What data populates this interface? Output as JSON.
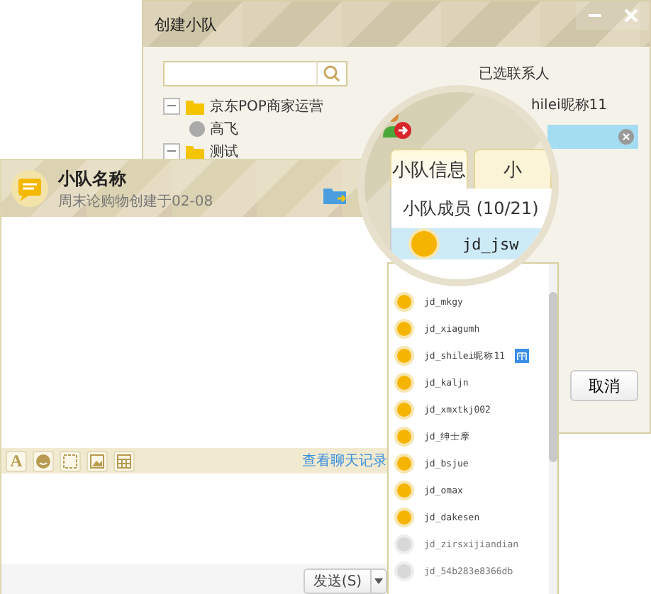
{
  "back_window": {
    "title": "创建小队",
    "tree": [
      {
        "label": "京东POP商家运营",
        "kind": "folder",
        "expanded": true,
        "children": [
          {
            "label": "高飞",
            "kind": "contact"
          }
        ]
      },
      {
        "label": "测试",
        "kind": "folder",
        "expanded": true
      }
    ],
    "selected_header": "已选联系人",
    "selected_contacts": [
      {
        "label": "hilei昵称11",
        "selected": false
      },
      {
        "selected": true
      }
    ],
    "buttons": [
      "取消"
    ]
  },
  "chat_window": {
    "font_button": "A",
    "team_name": "小队名称",
    "subtitle": "周末论购物创建于02-08",
    "history_link": "查看聊天记录",
    "send_button": "发送(S)"
  },
  "magnifier": {
    "tabs": [
      {
        "label": "小队信息",
        "selected": true
      },
      {
        "label": "小",
        "selected": false
      }
    ],
    "members_header": "小队成员 (10/21)",
    "highlighted_member": "jd_jsw"
  },
  "members": [
    {
      "name": "jd_mkgy",
      "online": true,
      "badge": false
    },
    {
      "name": "jd_xiagumh",
      "online": true,
      "badge": false
    },
    {
      "name": "jd_shilei昵称11",
      "online": true,
      "badge": true
    },
    {
      "name": "jd_kaljn",
      "online": true,
      "badge": false
    },
    {
      "name": "jd_xmxtkj002",
      "online": true,
      "badge": false
    },
    {
      "name": "jd_绅士摩",
      "online": true,
      "badge": false
    },
    {
      "name": "jd_bsjue",
      "online": true,
      "badge": false
    },
    {
      "name": "jd_omax",
      "online": true,
      "badge": false
    },
    {
      "name": "jd_dakesen",
      "online": true,
      "badge": false
    },
    {
      "name": "jd_zirsxijiandian",
      "online": false,
      "badge": false
    },
    {
      "name": "jd_54b283e8366db",
      "online": false,
      "badge": false
    }
  ]
}
